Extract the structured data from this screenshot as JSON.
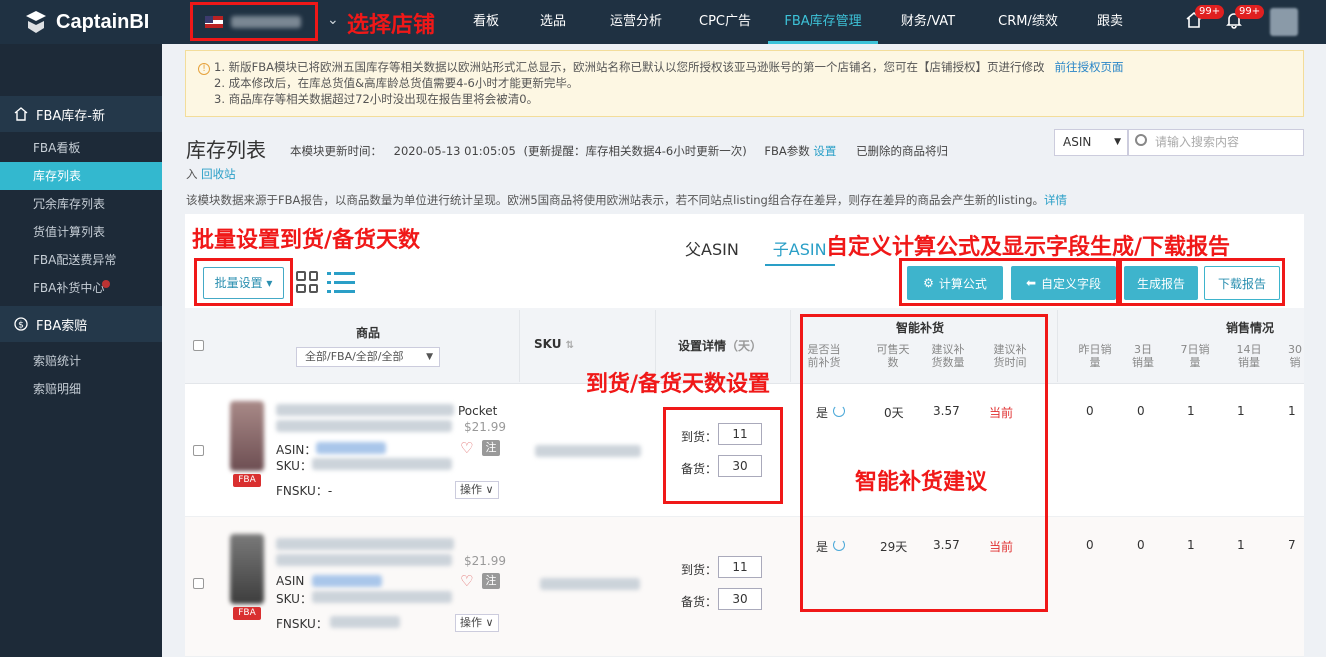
{
  "brand": {
    "name": "CaptainBI"
  },
  "nav": {
    "items": [
      "看板",
      "选品",
      "运营分析",
      "CPC广告",
      "FBA库存管理",
      "财务/VAT",
      "CRM/绩效",
      "跟卖"
    ],
    "active_index": 4,
    "badges": [
      "99+",
      "99+"
    ]
  },
  "sidebar": {
    "group1": "FBA库存-新",
    "items1": [
      "FBA看板",
      "库存列表",
      "冗余库存列表",
      "货值计算列表",
      "FBA配送费异常",
      "FBA补货中心"
    ],
    "active_index": 1,
    "group2": "FBA索赔",
    "items2": [
      "索赔统计",
      "索赔明细"
    ]
  },
  "notice": {
    "line1": "1. 新版FBA模块已将欧洲五国库存等相关数据以欧洲站形式汇总显示，欧洲站名称已默认以您所授权该亚马逊账号的第一个店铺名，您可在【店铺授权】页进行修改",
    "link": "前往授权页面",
    "line2": "2. 成本修改后，在库总货值&高库龄总货值需要4-6小时才能更新完毕。",
    "line3": "3. 商品库存等相关数据超过72小时没出现在报告里将会被清0。"
  },
  "page": {
    "title": "库存列表",
    "update_label": "本模块更新时间：",
    "update_time": "2020-05-13 01:05:05",
    "update_hint": "(更新提醒：库存相关数据4-6小时更新一次)",
    "fba_param": "FBA参数",
    "fba_param_link": "设置",
    "deleted_hint": "已删除的商品将归",
    "recycle_prefix": "入",
    "recycle_link": "回收站",
    "desc": "该模块数据来源于FBA报告，以商品数量为单位进行统计呈现。欧洲5国商品将使用欧洲站表示，若不同站点listing组合存在差异，则存在差异的商品会产生新的listing。",
    "desc_link": "详情"
  },
  "search": {
    "type": "ASIN",
    "placeholder": "请输入搜索内容"
  },
  "toolbar": {
    "batch": "批量设置",
    "parent_asin": "父ASIN",
    "child_asin": "子ASIN",
    "formula": "计算公式",
    "custom_fields": "自定义字段",
    "gen_report": "生成报告",
    "download_report": "下载报告"
  },
  "table": {
    "col_product": "商品",
    "product_filter": "全部/FBA/全部/全部",
    "col_sku": "SKU",
    "col_setting": "设置详情",
    "col_setting_unit": "（天）",
    "col_smart": "智能补货",
    "smart_sub": [
      "是否当前补货",
      "可售天数",
      "建议补货数量",
      "建议补货时间"
    ],
    "col_sales": "销售情况",
    "sales_sub": [
      "昨日销量",
      "3日销量",
      "7日销量",
      "14日销量",
      "30销"
    ]
  },
  "rows": [
    {
      "title_tail": "Pocket",
      "price": "$21.99",
      "asin_label": "ASIN：",
      "sku_label": "SKU：",
      "fnsku": "FNSKU：-",
      "note": "注",
      "op": "操作 ∨",
      "arrive_label": "到货：",
      "arrive": "11",
      "stock_label": "备货：",
      "stock": "30",
      "replenish": "是",
      "days": "0天",
      "qty": "3.57",
      "time": "当前",
      "sales": [
        "0",
        "0",
        "1",
        "1",
        "1"
      ],
      "fba": "FBA"
    },
    {
      "title_tail": "",
      "price": "$21.99",
      "asin_label": "ASIN",
      "sku_label": "SKU：",
      "fnsku": "FNSKU：",
      "note": "注",
      "op": "操作 ∨",
      "arrive_label": "到货：",
      "arrive": "11",
      "stock_label": "备货：",
      "stock": "30",
      "replenish": "是",
      "days": "29天",
      "qty": "3.57",
      "time": "当前",
      "sales": [
        "0",
        "0",
        "1",
        "1",
        "7"
      ],
      "fba": "FBA"
    }
  ],
  "annotations": {
    "store": "选择店铺",
    "batch": "批量设置到货/备货天数",
    "custom": "自定义计算公式及显示字段生成/下载报告",
    "setting": "到货/备货天数设置",
    "smart": "智能补货建议"
  },
  "colors": {
    "topbar": "#1f3142",
    "accent": "#3dc2d8",
    "annotation": "#f01818"
  }
}
